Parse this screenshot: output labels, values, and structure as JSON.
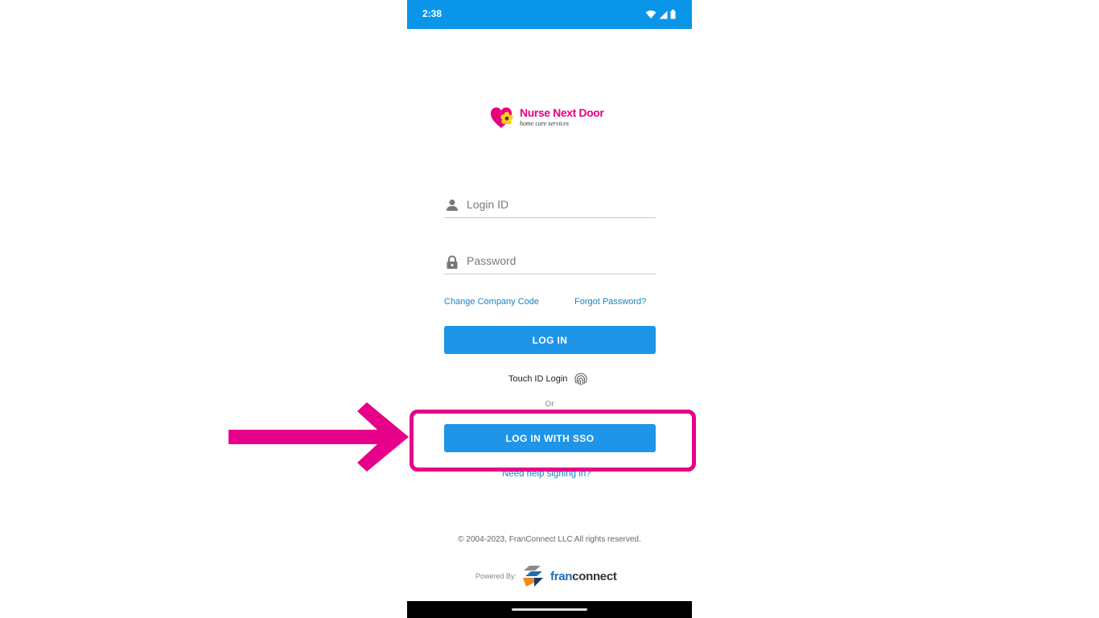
{
  "status_bar": {
    "time": "2:38"
  },
  "brand": {
    "name": "Nurse Next Door",
    "tagline": "home care services"
  },
  "login_form": {
    "login_id_placeholder": "Login ID",
    "password_placeholder": "Password",
    "change_company_code": "Change Company Code",
    "forgot_password": "Forgot Password?",
    "login_button": "LOG IN",
    "touch_id_label": "Touch ID Login",
    "or_text": "Or",
    "sso_button": "LOG IN WITH SSO",
    "help_link": "Need help signing in?"
  },
  "footer": {
    "copyright": "© 2004-2023, FranConnect LLC All rights reserved.",
    "powered_by_label": "Powered By:",
    "powered_by_brand_a": "fran",
    "powered_by_brand_b": "connect"
  },
  "colors": {
    "status_bar": "#0a96e8",
    "button": "#1e95e8",
    "link": "#1584c9",
    "highlight": "#e6008a"
  },
  "icons": [
    "wifi-icon",
    "signal-icon",
    "battery-icon",
    "user-icon",
    "lock-icon",
    "fingerprint-icon",
    "franconnect-logo-icon",
    "nurse-next-door-logo-icon"
  ]
}
